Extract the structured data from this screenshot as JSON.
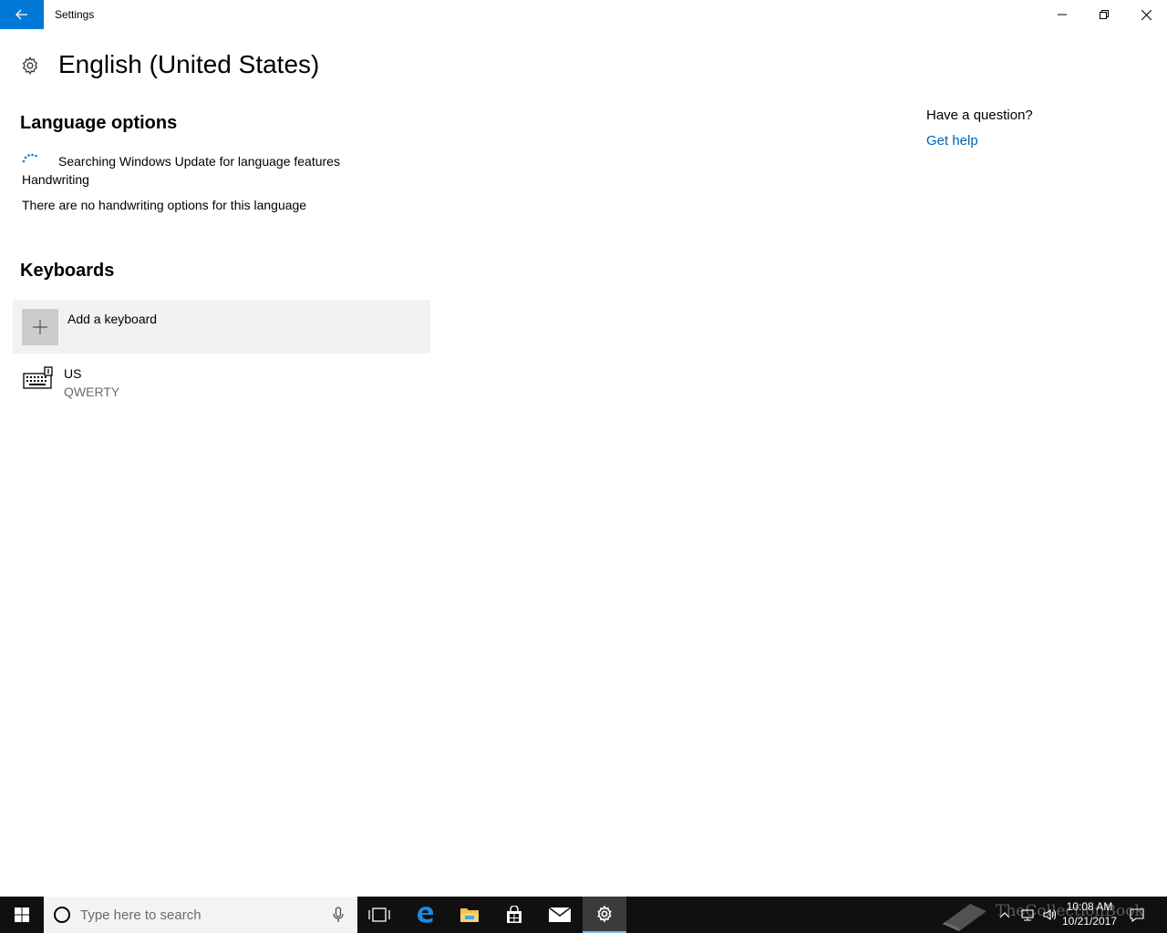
{
  "window": {
    "app_title": "Settings"
  },
  "page": {
    "title": "English (United States)"
  },
  "language_options": {
    "heading": "Language options",
    "status": "Searching Windows Update for language features",
    "handwriting_label": "Handwriting",
    "handwriting_desc": "There are no handwriting options for this language"
  },
  "keyboards": {
    "heading": "Keyboards",
    "add_label": "Add a keyboard",
    "items": [
      {
        "name": "US",
        "layout": "QWERTY"
      }
    ]
  },
  "help": {
    "question": "Have a question?",
    "link": "Get help"
  },
  "taskbar": {
    "search_placeholder": "Type here to search",
    "watermark": "TheCollectionBook",
    "time": "10:08 AM",
    "date": "10/21/2017"
  },
  "colors": {
    "accent": "#0078d7",
    "link": "#0063b1",
    "taskbar": "#101010"
  },
  "icons": [
    "back-arrow-icon",
    "minimize-icon",
    "restore-icon",
    "close-icon",
    "gear-icon",
    "spinner-icon",
    "plus-icon",
    "keyboard-icon",
    "windows-logo-icon",
    "cortana-icon",
    "microphone-icon",
    "task-view-icon",
    "edge-icon",
    "file-explorer-icon",
    "store-icon",
    "mail-icon",
    "settings-gear-icon",
    "chevron-up-icon",
    "network-icon",
    "volume-icon",
    "action-center-icon"
  ]
}
